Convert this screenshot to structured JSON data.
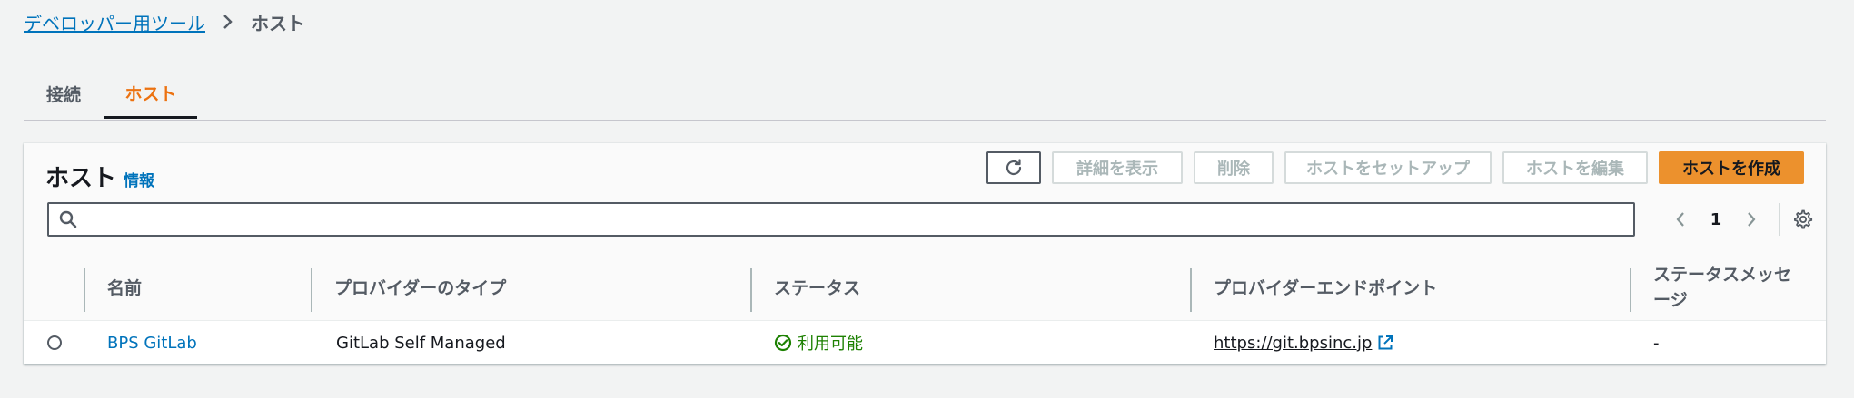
{
  "breadcrumb": {
    "parent": "デベロッパー用ツール",
    "current": "ホスト"
  },
  "tabs": [
    {
      "label": "接続",
      "active": false
    },
    {
      "label": "ホスト",
      "active": true
    }
  ],
  "panel": {
    "title": "ホスト",
    "info": "情報",
    "buttons": {
      "details": "詳細を表示",
      "delete": "削除",
      "setup": "ホストをセットアップ",
      "edit": "ホストを編集",
      "create": "ホストを作成"
    },
    "search": {
      "value": "",
      "placeholder": ""
    },
    "pagination": {
      "current_page": "1"
    }
  },
  "table": {
    "columns": [
      "名前",
      "プロバイダーのタイプ",
      "ステータス",
      "プロバイダーエンドポイント",
      "ステータスメッセージ"
    ],
    "rows": [
      {
        "name": "BPS GitLab",
        "provider_type": "GitLab Self Managed",
        "status": "利用可能",
        "endpoint": "https://git.bpsinc.jp",
        "status_message": "-"
      }
    ]
  },
  "colors": {
    "background": "#f2f3f3",
    "link": "#0073bb",
    "active_tab": "#ec7211",
    "primary_button": "#ec912d",
    "success": "#1d8102"
  },
  "icons": {
    "breadcrumb_sep": "chevron-right-icon",
    "refresh": "refresh-icon",
    "search": "search-icon",
    "prev": "chevron-left-icon",
    "next": "chevron-right-icon",
    "settings": "gear-icon",
    "status": "check-circle-icon",
    "external": "external-link-icon"
  }
}
